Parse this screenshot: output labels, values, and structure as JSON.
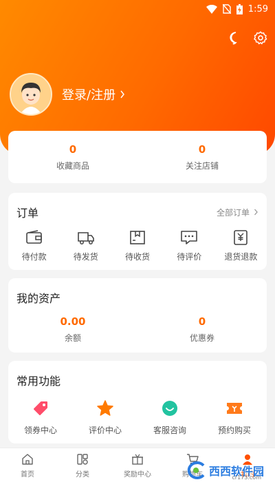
{
  "status": {
    "time": "1:59"
  },
  "profile": {
    "login_label": "登录/注册"
  },
  "favorites": [
    {
      "value": "0",
      "label": "收藏商品"
    },
    {
      "value": "0",
      "label": "关注店铺"
    }
  ],
  "orders": {
    "title": "订单",
    "all_label": "全部订单",
    "items": [
      {
        "label": "待付款",
        "icon": "wallet-icon"
      },
      {
        "label": "待发货",
        "icon": "truck-icon"
      },
      {
        "label": "待收货",
        "icon": "package-icon"
      },
      {
        "label": "待评价",
        "icon": "comment-icon"
      },
      {
        "label": "退货退款",
        "icon": "refund-icon"
      }
    ]
  },
  "assets": {
    "title": "我的资产",
    "items": [
      {
        "value": "0.00",
        "label": "余额"
      },
      {
        "value": "0",
        "label": "优惠券"
      }
    ]
  },
  "functions": {
    "title": "常用功能",
    "items": [
      {
        "label": "领券中心",
        "icon": "coupon-tag-icon",
        "color": "#ff4d6a"
      },
      {
        "label": "评价中心",
        "icon": "star-icon",
        "color": "#ff7a00"
      },
      {
        "label": "客服咨询",
        "icon": "service-icon",
        "color": "#22c3a0"
      },
      {
        "label": "预约购买",
        "icon": "ticket-icon",
        "color": "#ff7a1a"
      }
    ]
  },
  "tabbar": [
    {
      "label": "首页",
      "icon": "home-icon"
    },
    {
      "label": "分类",
      "icon": "category-icon"
    },
    {
      "label": "奖励中心",
      "icon": "reward-icon"
    },
    {
      "label": "购物车",
      "icon": "cart-icon"
    },
    {
      "label": "我的",
      "icon": "user-icon",
      "active": true
    }
  ],
  "watermark": {
    "text": "西西软件园",
    "url": "cr173.com"
  },
  "colors": {
    "accent": "#ff6a00",
    "header_start": "#ff8a00",
    "header_end": "#ff4800"
  }
}
